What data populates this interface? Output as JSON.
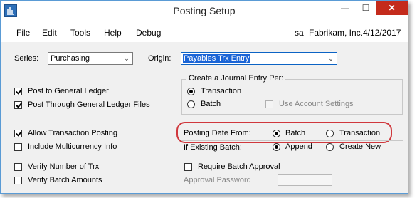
{
  "window": {
    "title": "Posting Setup",
    "minimize_glyph": "—",
    "maximize_glyph": "☐",
    "close_glyph": "✕"
  },
  "menu": {
    "items": [
      "File",
      "Edit",
      "Tools",
      "Help",
      "Debug"
    ],
    "user": "sa",
    "company": "Fabrikam, Inc.",
    "date": "4/12/2017"
  },
  "series": {
    "label": "Series:",
    "value": "Purchasing"
  },
  "origin": {
    "label": "Origin:",
    "value": "Payables Trx Entry"
  },
  "left_options": {
    "post_to_gl": {
      "label": "Post to General Ledger",
      "checked": true
    },
    "post_through_gl": {
      "label": "Post Through General Ledger Files",
      "checked": true
    },
    "allow_transaction_posting": {
      "label": "Allow Transaction Posting",
      "checked": true
    },
    "include_multicurrency": {
      "label": "Include Multicurrency Info",
      "checked": false
    },
    "verify_number_of_trx": {
      "label": "Verify Number of Trx",
      "checked": false
    },
    "verify_batch_amounts": {
      "label": "Verify Batch Amounts",
      "checked": false
    }
  },
  "journal_entry": {
    "title": "Create a Journal Entry Per:",
    "transaction_label": "Transaction",
    "batch_label": "Batch",
    "selected": "Transaction",
    "use_account_settings_label": "Use Account Settings"
  },
  "posting_date_from": {
    "label": "Posting Date From:",
    "batch_label": "Batch",
    "transaction_label": "Transaction",
    "selected": "Batch"
  },
  "if_existing_batch": {
    "label": "If Existing Batch:",
    "append_label": "Append",
    "create_new_label": "Create New",
    "selected": "Append"
  },
  "require_batch_approval": {
    "label": "Require Batch Approval",
    "checked": false
  },
  "approval_password": {
    "label": "Approval Password",
    "value": ""
  },
  "colors": {
    "highlight": "#d0383d",
    "accent": "#1a64d6",
    "close": "#c42b1c"
  },
  "icons": {
    "app": "app-window-icon",
    "dropdown": "chevron-down-icon"
  }
}
